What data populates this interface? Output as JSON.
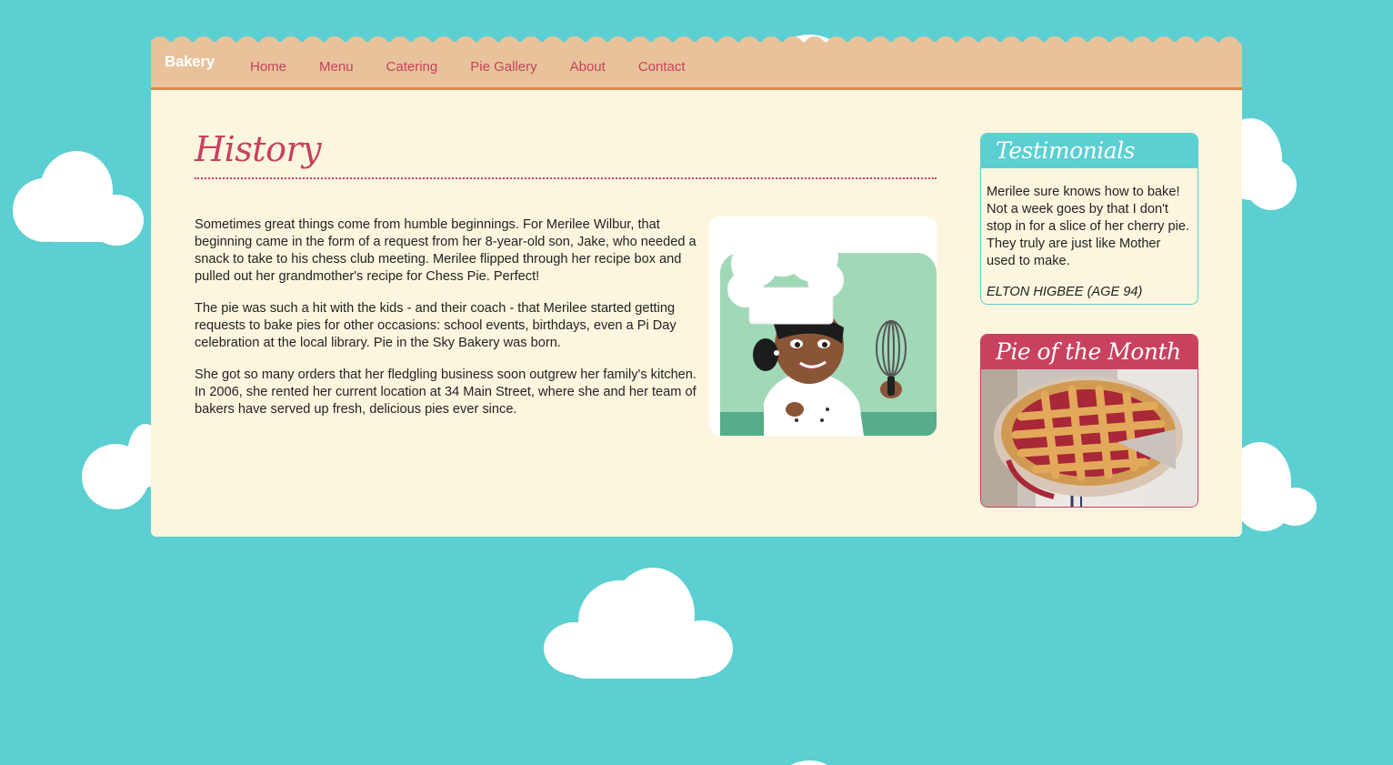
{
  "nav": {
    "brand": "Bakery",
    "links": [
      {
        "label": "Home"
      },
      {
        "label": "Menu"
      },
      {
        "label": "Catering"
      },
      {
        "label": "Pie Gallery"
      },
      {
        "label": "About"
      },
      {
        "label": "Contact"
      }
    ]
  },
  "main": {
    "heading": "History",
    "paragraphs": [
      "Sometimes great things come from humble beginnings. For Merilee Wilbur, that beginning came in the form of a request from her 8-year-old son, Jake, who needed a snack to take to his chess club meeting. Merilee flipped through her recipe box and pulled out her grandmother's recipe for Chess Pie. Perfect!",
      "The pie was such a hit with the kids - and their coach - that Merilee started getting requests to bake pies for other occasions: school events, birthdays, even a Pi Day celebration at the local library. Pie in the Sky Bakery was born.",
      "She got so many orders that her fledgling business soon outgrew her family's kitchen. In 2006, she rented her current location at 34 Main Street, where she and her team of bakers have served up fresh, delicious pies ever since."
    ]
  },
  "sidebar": {
    "testimonials": {
      "title": "Testimonials",
      "quote": "Merilee sure knows how to bake! Not a week goes by that I don't stop in for a slice of her cherry pie. They truly are just like Mother used to make.",
      "author": "ELTON HIGBEE (AGE 94)"
    },
    "pie_of_month": {
      "title": "Pie of the Month"
    }
  },
  "colors": {
    "sky": "#5bcfd1",
    "page": "#fdf6df",
    "nav": "#e8c29a",
    "accent": "#c8415f",
    "nav_border": "#d98a4f"
  }
}
